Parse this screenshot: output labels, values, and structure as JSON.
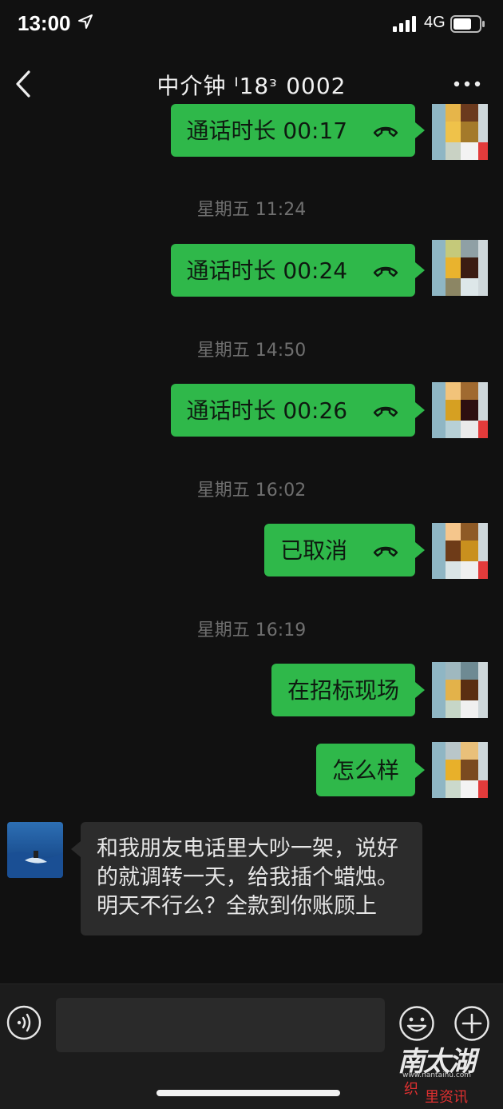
{
  "status_bar": {
    "time": "13:00",
    "network": "4G"
  },
  "nav": {
    "title": "中介钟     ᴵ18ᵌ      0002"
  },
  "messages": [
    {
      "type": "out",
      "text": "通话时长 00:17",
      "icon": "phone-hangup-icon"
    },
    {
      "type": "time",
      "text": "星期五 11:24"
    },
    {
      "type": "out",
      "text": "通话时长 00:24",
      "icon": "phone-hangup-icon"
    },
    {
      "type": "time",
      "text": "星期五 14:50"
    },
    {
      "type": "out",
      "text": "通话时长 00:26",
      "icon": "phone-hangup-icon"
    },
    {
      "type": "time",
      "text": "星期五 16:02"
    },
    {
      "type": "out",
      "text": "已取消",
      "icon": "phone-hangup-icon"
    },
    {
      "type": "time",
      "text": "星期五 16:19"
    },
    {
      "type": "out",
      "text": "在招标现场"
    },
    {
      "type": "out",
      "text": "怎么样"
    },
    {
      "type": "in",
      "text": "和我朋友电话里大吵一架，说好的就调转一天，给我插个蜡烛。明天不行么？全款到你账顾上"
    }
  ],
  "input_bar": {
    "placeholder": "",
    "icons": [
      "voice-icon",
      "emoji-icon",
      "plus-icon"
    ]
  },
  "watermark": {
    "main": "南太湖",
    "url": "www.nantaihu.com",
    "sub1": "织",
    "sub2": "里资讯"
  },
  "colors": {
    "background": "#111111",
    "bubble_out": "#2fb84a",
    "bubble_in": "#2c2c2c",
    "timestamp": "#6f6f6f"
  }
}
